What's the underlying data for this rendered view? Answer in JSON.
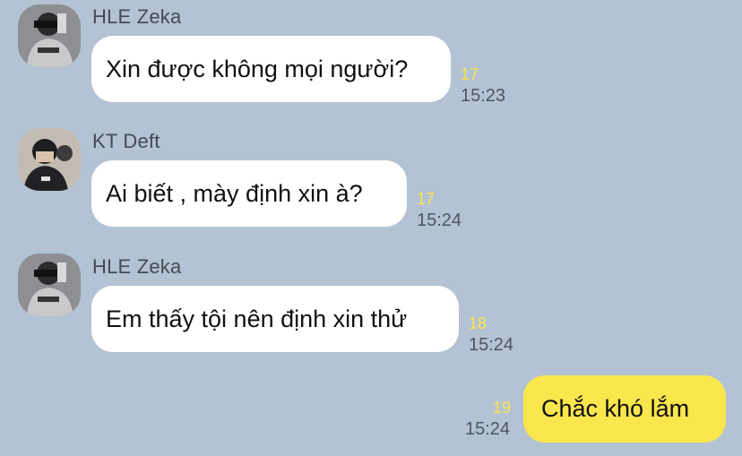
{
  "messages": [
    {
      "sender": "HLE Zeka",
      "text": "Xin được không mọi người?",
      "unread": "17",
      "time": "15:23",
      "avatar": "zeka-avatar-icon"
    },
    {
      "sender": "KT Deft",
      "text": "Ai biết , mày định xin à?",
      "unread": "17",
      "time": "15:24",
      "avatar": "deft-avatar-icon"
    },
    {
      "sender": "HLE Zeka",
      "text": "Em thấy tội nên định xin thử",
      "unread": "18",
      "time": "15:24",
      "avatar": "zeka-avatar-icon"
    },
    {
      "sender": "",
      "text": "Chắc khó lắm",
      "unread": "19",
      "time": "15:24",
      "mine": true
    }
  ],
  "colors": {
    "background": "#b3c3d4",
    "incoming_bubble": "#ffffff",
    "outgoing_bubble": "#fae64d",
    "unread_count": "#fae64d"
  }
}
